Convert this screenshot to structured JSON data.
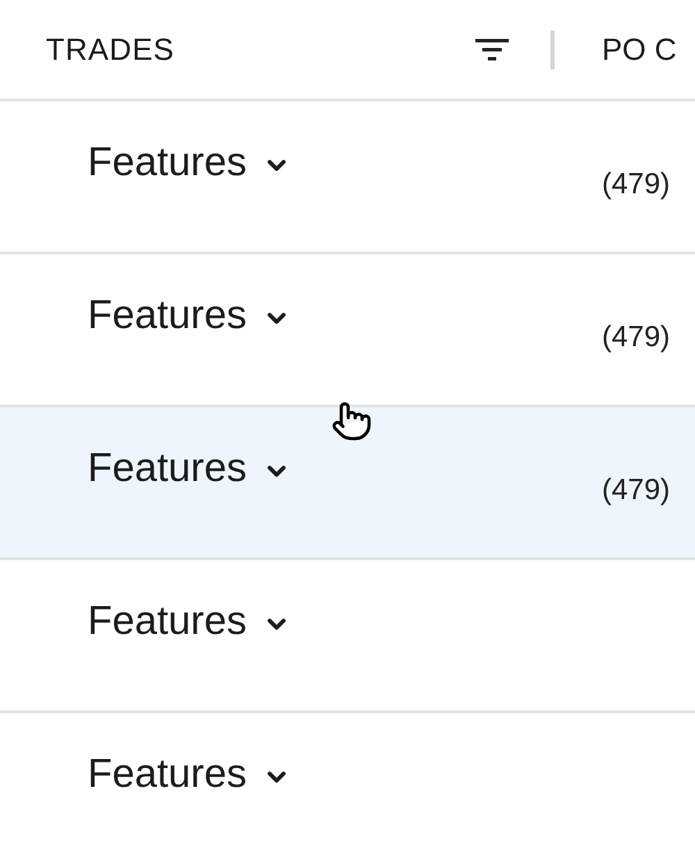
{
  "table": {
    "columns": [
      {
        "label": "TRADES",
        "filter": true
      },
      {
        "label": "PO C"
      }
    ],
    "rows": [
      {
        "trade": "Features",
        "column_2": "(479)",
        "hovered": false
      },
      {
        "trade": "Features",
        "column_2": "(479)",
        "hovered": false
      },
      {
        "trade": "Features",
        "column_2": "(479)",
        "hovered": true
      },
      {
        "trade": "Features",
        "hovered": false
      },
      {
        "trade": "Features",
        "hovered": false
      }
    ]
  }
}
